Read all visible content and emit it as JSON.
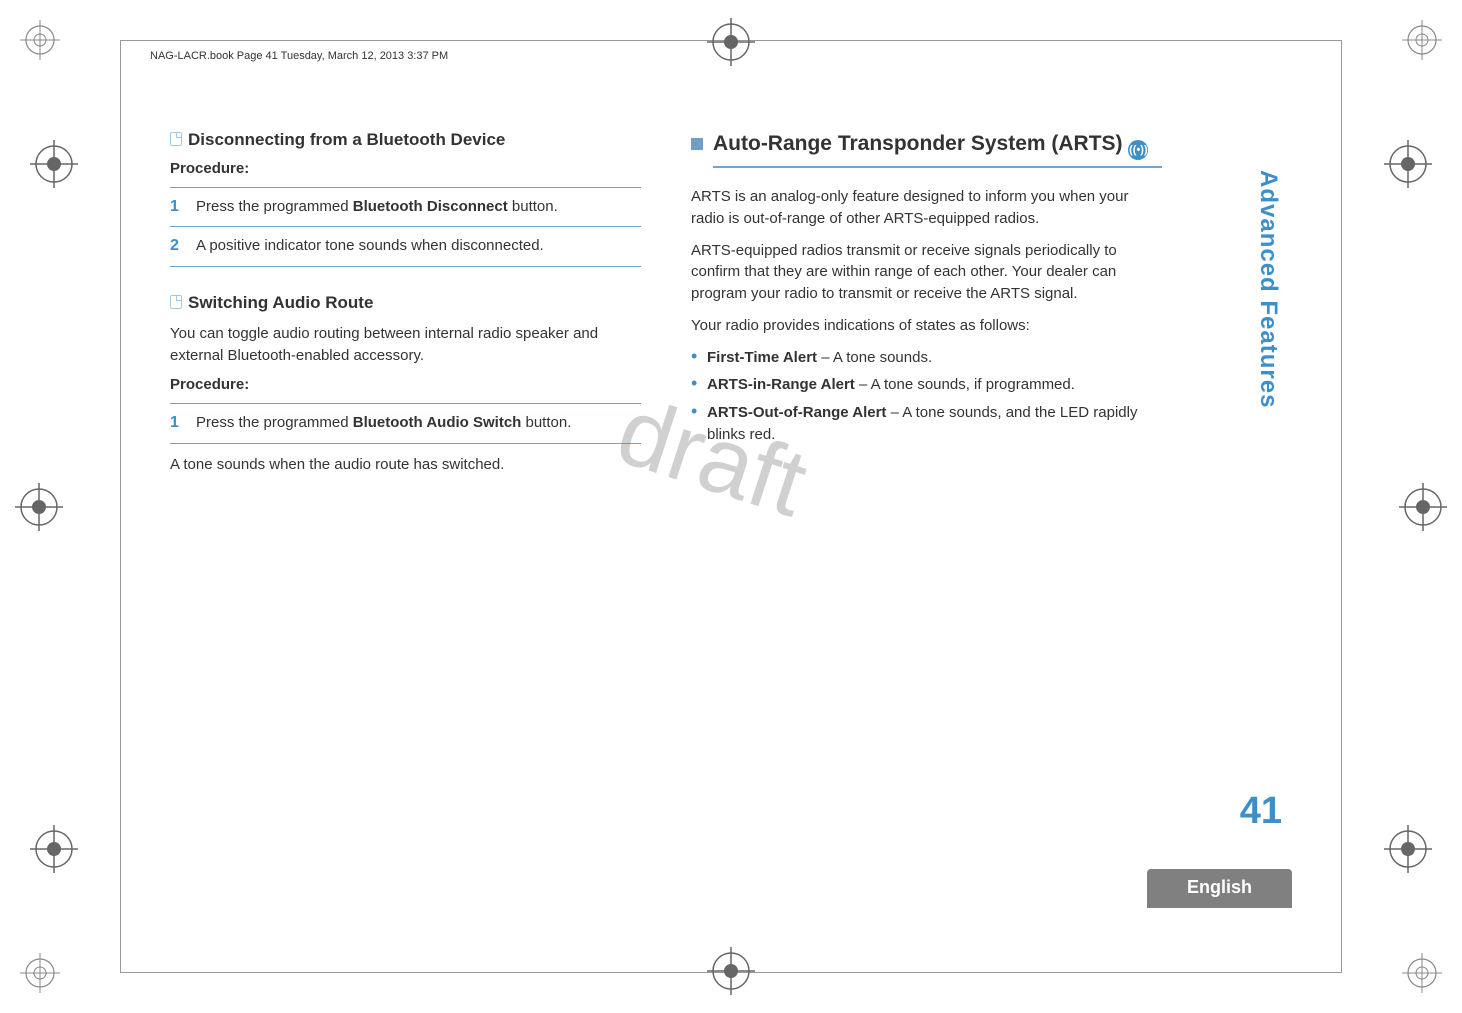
{
  "header": "NAG-LACR.book  Page 41  Tuesday, March 12, 2013  3:37 PM",
  "watermark": "draft",
  "side_tab": "Advanced Features",
  "page_number": "41",
  "language": "English",
  "left": {
    "h1": "Disconnecting from a Bluetooth Device",
    "proc1": "Procedure:",
    "s1_num": "1",
    "s1_a": "Press the programmed ",
    "s1_b": "Bluetooth Disconnect",
    "s1_c": " button.",
    "s2_num": "2",
    "s2": "A positive indicator tone sounds when disconnected.",
    "h2": "Switching Audio Route",
    "p1": "You can toggle audio routing between internal radio speaker and external Bluetooth-enabled accessory.",
    "proc2": "Procedure:",
    "s3_num": "1",
    "s3_a": "Press the programmed ",
    "s3_b": "Bluetooth Audio Switch",
    "s3_c": " button.",
    "p2": "A tone sounds when the audio route has switched."
  },
  "right": {
    "heading_a": "Auto-Range Transponder System (ARTS) ",
    "p1": "ARTS is an analog-only feature designed to inform you when your radio is out-of-range of other ARTS-equipped radios.",
    "p2": "ARTS-equipped radios transmit or receive signals periodically to confirm that they are within range of each other. Your dealer can program your radio to transmit or receive the ARTS signal.",
    "p3": "Your radio provides indications of states as follows:",
    "b1_a": "First-Time Alert",
    "b1_b": " – A tone sounds.",
    "b2_a": "ARTS-in-Range Alert",
    "b2_b": " – A tone sounds, if programmed.",
    "b3_a": "ARTS-Out-of-Range Alert",
    "b3_b": " – A tone sounds, and the LED rapidly blinks red."
  }
}
